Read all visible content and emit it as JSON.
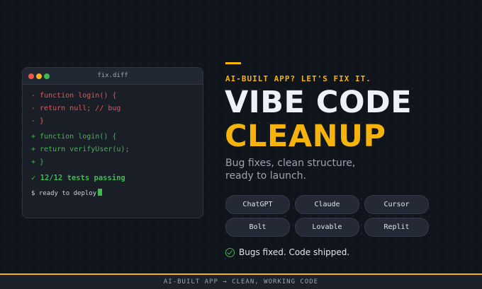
{
  "terminal": {
    "title": "fix.diff",
    "removed": [
      "- function login() {",
      "- return null; // bug",
      "- }"
    ],
    "added": [
      "+ function login() {",
      "+ return verifyUser(u);",
      "+ }"
    ],
    "tests": "✓ 12/12 tests passing",
    "prompt": "$ ready to deploy"
  },
  "hero": {
    "kicker": "AI-BUILT APP? LET'S FIX IT.",
    "title_line1": "VIBE CODE",
    "title_line2": "CLEANUP",
    "subtitle": "Bug fixes, clean structure, ready to launch."
  },
  "tools": [
    "ChatGPT",
    "Claude",
    "Cursor",
    "Bolt",
    "Lovable",
    "Replit"
  ],
  "status": "Bugs fixed. Code shipped.",
  "footer": "AI-BUILT APP → CLEAN, WORKING CODE",
  "colors": {
    "accent": "#f5b30b",
    "added": "#3fb950",
    "removed": "#ef5350",
    "background": "#10141b"
  }
}
